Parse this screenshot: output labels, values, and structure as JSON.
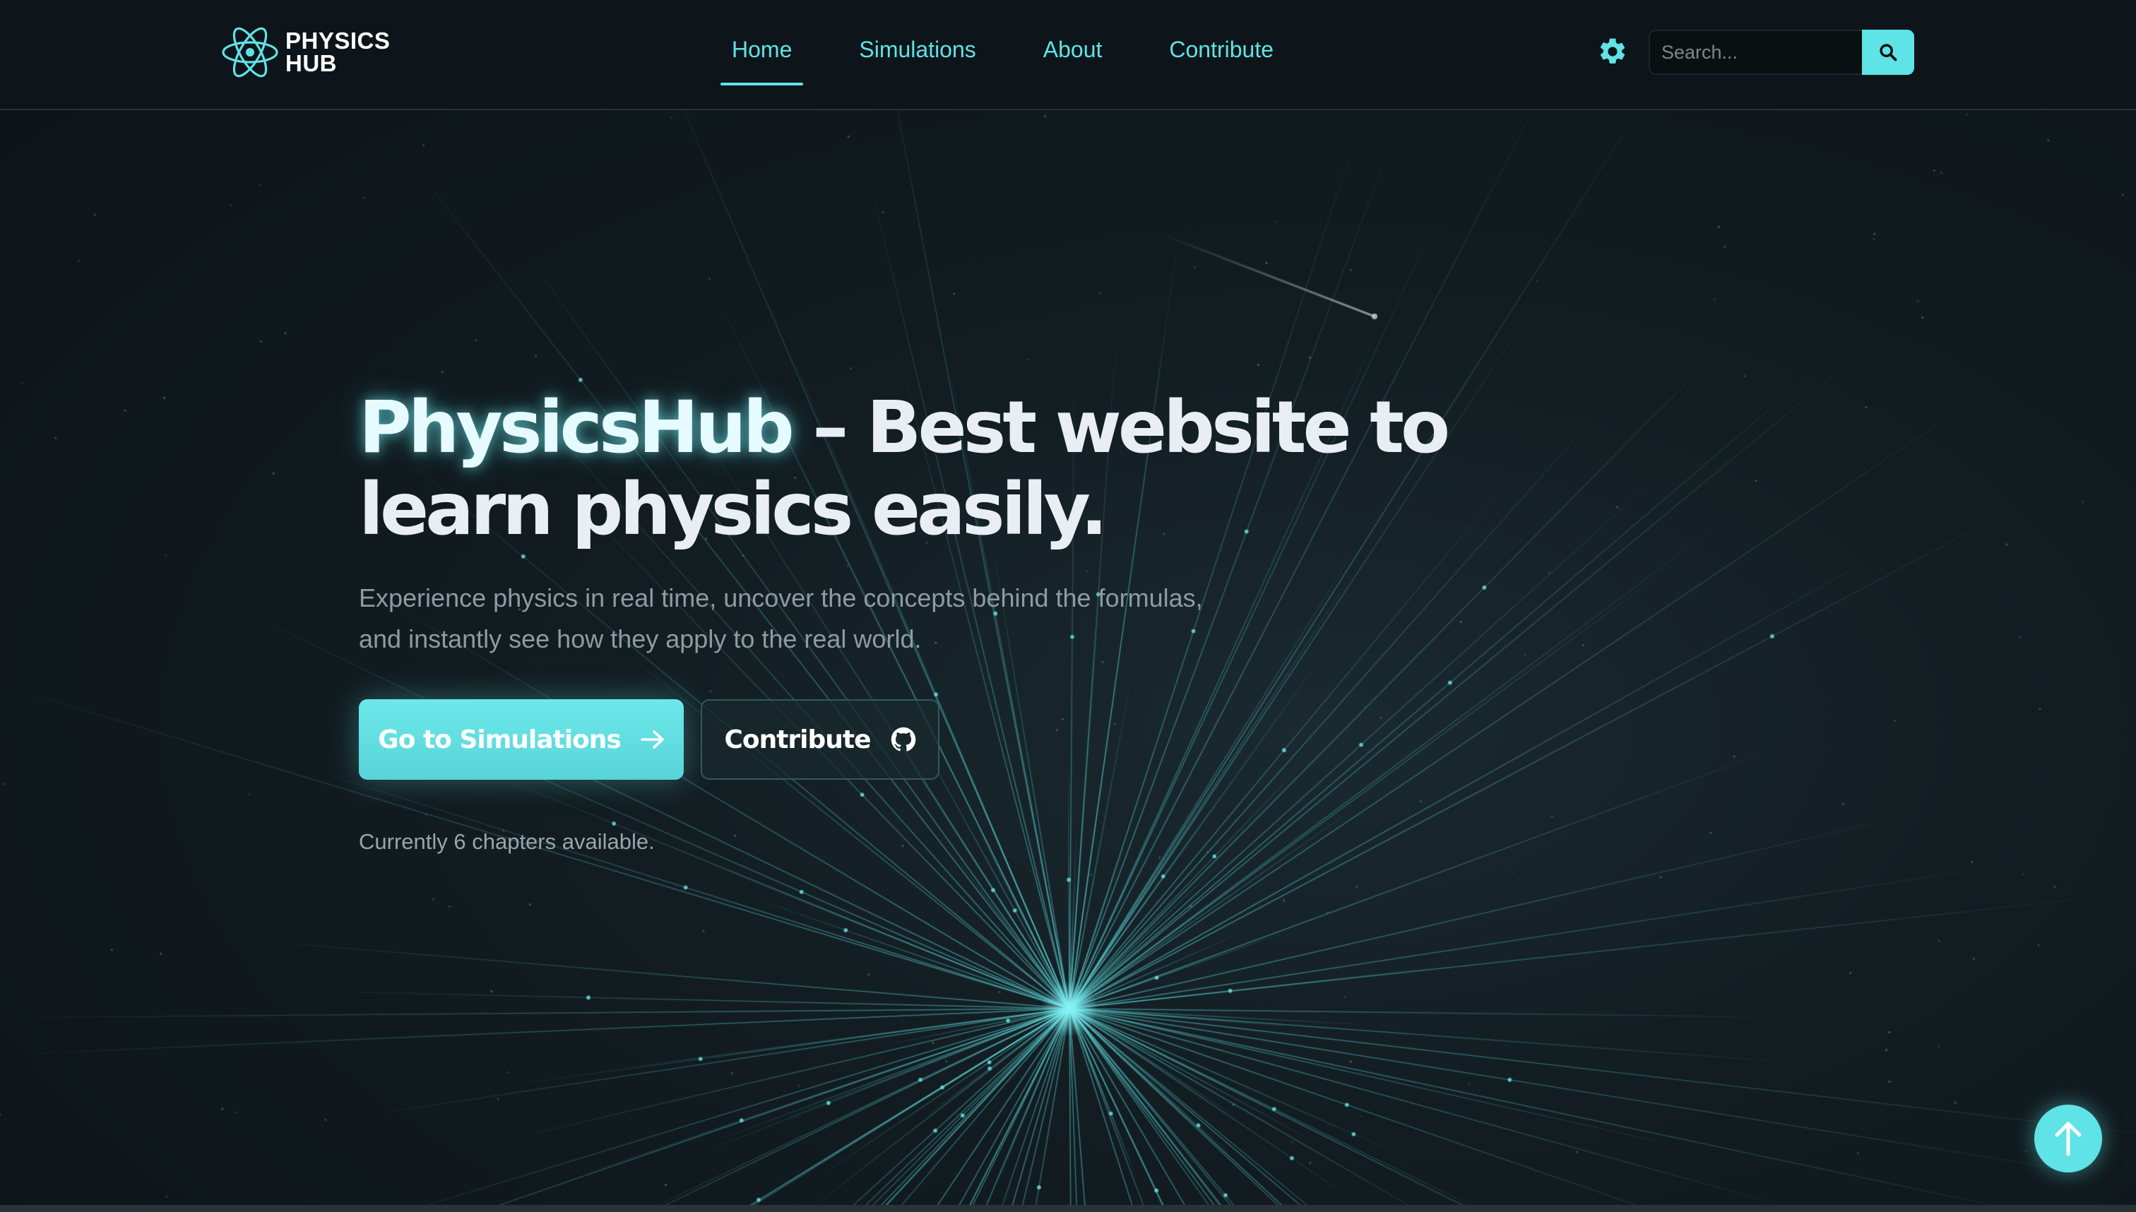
{
  "brand": {
    "logo_line1": "PHYSICS",
    "logo_line2": "HUB",
    "logo_icon": "atom-icon"
  },
  "nav": {
    "items": [
      {
        "label": "Home",
        "active": true
      },
      {
        "label": "Simulations",
        "active": false
      },
      {
        "label": "About",
        "active": false
      },
      {
        "label": "Contribute",
        "active": false
      }
    ]
  },
  "header_tools": {
    "settings_icon": "gear-icon",
    "search_placeholder": "Search...",
    "search_value": "",
    "search_icon": "search-icon"
  },
  "hero": {
    "title_brand": "PhysicsHub",
    "title_rest": " – Best website to learn physics easily.",
    "subtitle": "Experience physics in real time, uncover the concepts behind the formulas, and instantly see how they apply to the real world.",
    "primary_button": "Go to Simulations",
    "primary_icon": "arrow-right-icon",
    "secondary_button": "Contribute",
    "secondary_icon": "github-icon",
    "chapters_note": "Currently 6 chapters available."
  },
  "scroll_top": {
    "icon": "arrow-up-icon"
  },
  "colors": {
    "accent": "#5fe3e6",
    "background": "#0c1216",
    "title": "#e9eef4",
    "muted_text": "#8e9ba2"
  }
}
